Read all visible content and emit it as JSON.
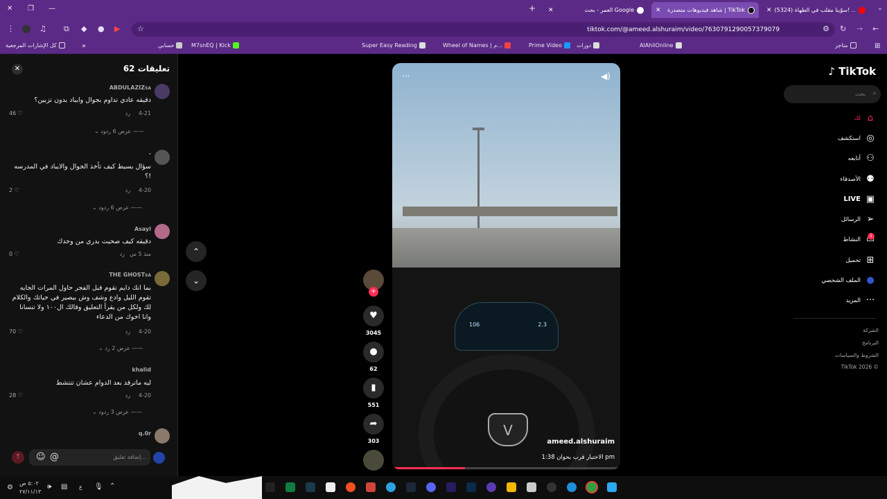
{
  "browser": {
    "tabs": [
      {
        "title": "(5324) سوّينا مقلب في الطهاة! ...",
        "icon": "youtube-icon",
        "active": false
      },
      {
        "title": "شاهد فيديوهات متصدرة | TikTok",
        "icon": "tiktok-icon",
        "active": true
      },
      {
        "title": "العمر - بحث Google",
        "icon": "google-icon",
        "active": false
      }
    ],
    "url": "tiktok.com/@ameed.alshuraim/video/7630791290057379079",
    "bookmarks": [
      "متاجر",
      "دورات",
      "Prime Video",
      "Wheel of Names | م...",
      "Super Easy Reading",
      "M7snEQ | Kick",
      "حسابي",
      "كل الإشارات المرجعية",
      "AlAhliOnline"
    ]
  },
  "comments": {
    "title": "تعليقات 62",
    "items": [
      {
        "user": "ABDULAZIZ",
        "user_suffix": "SA",
        "text": "دقيقه عادي تداوم بجوال وايباد بدون تزبين؟",
        "date": "4-21",
        "reply": "رد",
        "likes": "46",
        "replies": "عرض 6 ردود"
      },
      {
        "user": "-",
        "user_suffix": "",
        "text": "سؤال بسيط كيف تأخذ الجوال والايباد في المدرسه ؟!",
        "date": "4-20",
        "reply": "رد",
        "likes": "2",
        "replies": "عرض 6 ردود"
      },
      {
        "user": "Asayl",
        "user_suffix": "",
        "text": "دقيقه كيف صحيت بدري من وحدك",
        "date": "منذ 5 س",
        "reply": "رد",
        "likes": "0",
        "replies": ""
      },
      {
        "user": "THE GHOST",
        "user_suffix": "SA",
        "text": "بما انك دايم تقوم قبل الفجر حاول المرات الجايه تقوم الليل وادع وشف وش بيصير في حياتك والكلام لك ولكل من يقرأ التعليق وقالك ال١٠٠ ولا تنسانا وانا اخوك من الدعاء",
        "date": "4-20",
        "reply": "رد",
        "likes": "70",
        "replies": "عرض 2 رد"
      },
      {
        "user": "khalid",
        "user_suffix": "",
        "text": "ليه ماترقد بعد الدوام عشان تتنشط",
        "date": "4-20",
        "reply": "رد",
        "likes": "28",
        "replies": "عرض 3 ردود"
      },
      {
        "user": "q.0r",
        "user_suffix": "",
        "text": "",
        "date": "",
        "reply": "",
        "likes": "",
        "replies": ""
      }
    ],
    "add_placeholder": "إضافة تعليق..."
  },
  "video": {
    "username": "ameed.alshuraim",
    "caption": "الاختبار قرب بحوان 1:38 pm",
    "progress": 0.32,
    "speed_left": "106",
    "speed_right": "2.3"
  },
  "actions": {
    "likes": "3045",
    "comments": "62",
    "saves": "551",
    "shares": "303"
  },
  "sidebar": {
    "brand": "TikTok",
    "search_placeholder": "بحث",
    "items": [
      {
        "label": "لك",
        "icon": "home-icon"
      },
      {
        "label": "استكشف",
        "icon": "compass-icon"
      },
      {
        "label": "أتابعه",
        "icon": "following-icon"
      },
      {
        "label": "الأصدقاء",
        "icon": "friends-icon"
      },
      {
        "label": "LIVE",
        "icon": "live-icon"
      },
      {
        "label": "الرسائل",
        "icon": "messages-icon"
      },
      {
        "label": "النشاط",
        "icon": "activity-icon"
      },
      {
        "label": "تحميل",
        "icon": "upload-icon"
      },
      {
        "label": "الملف الشخصي",
        "icon": "profile-icon"
      },
      {
        "label": "المزيد",
        "icon": "more-icon"
      }
    ],
    "activity_badge": "1",
    "footer": [
      "الشركة",
      "البرنامج",
      "الشروط والسياسات",
      "TikTok 2026 ©"
    ]
  },
  "taskbar": {
    "time": "٥:٠٢ ص",
    "date": "٢٧/١١/١٣",
    "lang": "ع"
  },
  "colors": {
    "accent": "#fe2c55",
    "chrome": "#5b2a86"
  }
}
